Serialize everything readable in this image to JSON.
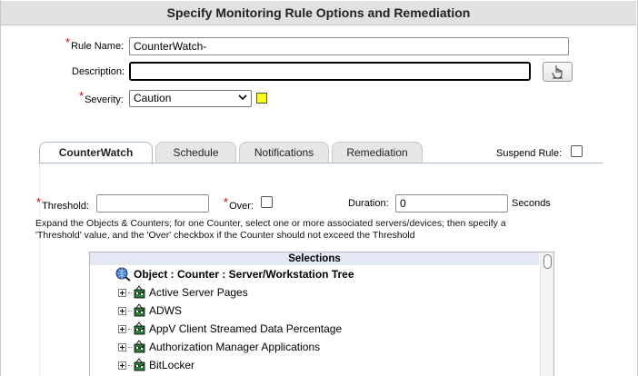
{
  "title": "Specify Monitoring Rule Options and Remediation",
  "form": {
    "rule_name_label": "Rule Name:",
    "rule_name_value": "CounterWatch-",
    "description_label": "Description:",
    "description_value": "",
    "severity_label": "Severity:",
    "severity_value": "Caution",
    "severity_color": "#ffff00",
    "required_marker": "*"
  },
  "tabs": [
    {
      "label": "CounterWatch",
      "active": true
    },
    {
      "label": "Schedule",
      "active": false
    },
    {
      "label": "Notifications",
      "active": false
    },
    {
      "label": "Remediation",
      "active": false
    }
  ],
  "suspend_label": "Suspend Rule:",
  "counterwatch": {
    "threshold_label": "Threshold:",
    "threshold_value": "",
    "over_label": "Over:",
    "duration_label": "Duration:",
    "duration_value": "0",
    "duration_unit": "Seconds",
    "help_text": "Expand the Objects & Counters; for one Counter, select one or more associated servers/devices; then specify a 'Threshold' value, and the 'Over' checkbox if the Counter should not exceed the Threshold"
  },
  "selections": {
    "header": "Selections",
    "root_label": "Object : Counter : Server/Workstation Tree",
    "items": [
      "Active Server Pages",
      "ADWS",
      "AppV Client Streamed Data Percentage",
      "Authorization Manager Applications",
      "BitLocker"
    ]
  }
}
